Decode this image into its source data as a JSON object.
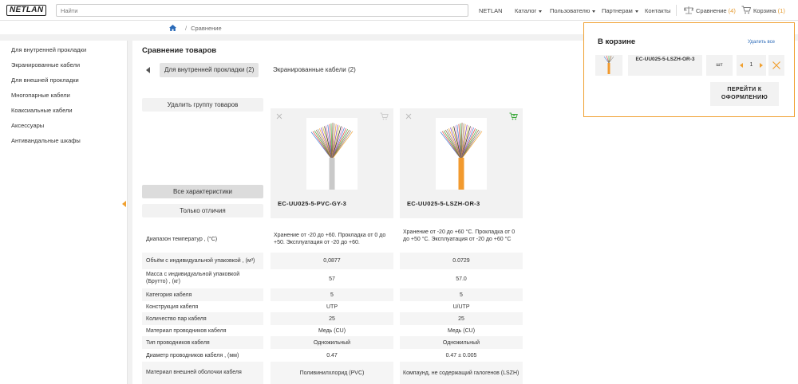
{
  "header": {
    "logo": "NETLAN",
    "search_placeholder": "Найти",
    "nav": [
      "NETLAN",
      "Каталог",
      "Пользователю",
      "Партнерам",
      "Контакты"
    ],
    "compare_label": "Сравнение",
    "compare_count": "(4)",
    "cart_label": "Корзина",
    "cart_count": "(1)"
  },
  "breadcrumb": {
    "current": "Сравнение"
  },
  "sidebar": {
    "items": [
      "Для внутренней прокладки",
      "Экранированные кабели",
      "Для внешней прокладки",
      "Многопарные кабели",
      "Коаксиальные кабели",
      "Аксессуары",
      "Антивандальные шкафы"
    ]
  },
  "main": {
    "title": "Сравнение товаров",
    "tabs": [
      "Для внутренней прокладки (2)",
      "Экранированные кабели (2)"
    ],
    "delete_group": "Удалить группу товаров",
    "all_specs": "Все характеристики",
    "only_diff": "Только отличия"
  },
  "products": [
    {
      "name": "EC-UU025-5-PVC-GY-3",
      "jacket_color": "#c9c9c9"
    },
    {
      "name": "EC-UU025-5-LSZH-OR-3",
      "jacket_color": "#f29a2e"
    }
  ],
  "specs": [
    {
      "label": "Диапазон температур , (°С)",
      "values": [
        "Хранение от -20 до +60. Прокладка от 0 до +50. Эксплуатация от -20 до +60.",
        "Хранение от -20 до +60 °С. Прокладка от 0 до +50 °С. Эксплуатация от -20 до +60 °С"
      ]
    },
    {
      "label": "Объём с индивидуальной упаковкой , (м³)",
      "values": [
        "0,0877",
        "0.0729"
      ]
    },
    {
      "label": "Масса с индивидуальной упаковкой (Брутто) , (кг)",
      "values": [
        "57",
        "57.0"
      ]
    },
    {
      "label": "Категория кабеля",
      "values": [
        "5",
        "5"
      ]
    },
    {
      "label": "Конструкция кабеля",
      "values": [
        "UTP",
        "U/UTP"
      ]
    },
    {
      "label": "Количество пар кабеля",
      "values": [
        "25",
        "25"
      ]
    },
    {
      "label": "Материал проводников кабеля",
      "values": [
        "Медь (CU)",
        "Медь (CU)"
      ]
    },
    {
      "label": "Тип проводников кабеля",
      "values": [
        "Одножильный",
        "Одножильный"
      ]
    },
    {
      "label": "Диаметр проводников кабеля , (мм)",
      "values": [
        "0.47",
        "0.47 ± 0.005"
      ]
    },
    {
      "label": "Материал внешней оболочки кабеля",
      "values": [
        "Поливинилхлорид (PVC)",
        "Компаунд, не содержащий галогенов (LSZH)"
      ]
    }
  ],
  "cart_popup": {
    "title": "В корзине",
    "clear_label": "Удалить все",
    "item_name": "EC-UU025-5-LSZH-OR-3",
    "unit": "шт",
    "qty": "1",
    "checkout_label": "ПЕРЕЙТИ К ОФОРМЛЕНИЮ"
  },
  "colors": {
    "accent": "#f0a030",
    "link": "#2a6ab8",
    "cart_green": "#3aa83a"
  }
}
